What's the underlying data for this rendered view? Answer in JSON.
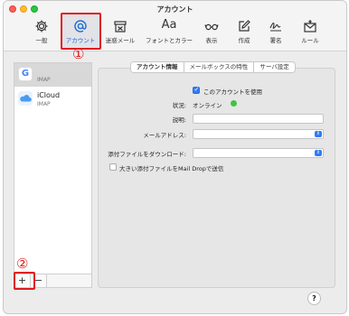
{
  "window": {
    "title": "アカウント"
  },
  "toolbar": {
    "items": [
      {
        "label": "一般",
        "icon": "gear-icon"
      },
      {
        "label": "アカウント",
        "icon": "at-sign-icon",
        "active": true
      },
      {
        "label": "迷惑メール",
        "icon": "junk-mail-icon"
      },
      {
        "label": "フォントとカラー",
        "icon": "font-icon",
        "glyph": "Aa"
      },
      {
        "label": "表示",
        "icon": "glasses-icon"
      },
      {
        "label": "作成",
        "icon": "compose-icon"
      },
      {
        "label": "署名",
        "icon": "signature-icon"
      },
      {
        "label": "ルール",
        "icon": "rules-envelope-icon"
      }
    ],
    "accent": "#1a6cd6"
  },
  "annotations": {
    "callout1": "①",
    "callout2": "②",
    "color": "#e0191b"
  },
  "sidebar": {
    "accounts": [
      {
        "name": "",
        "type": "IMAP",
        "icon": "google-icon",
        "selected": true
      },
      {
        "name": "iCloud",
        "type": "IMAP",
        "icon": "icloud-icon",
        "selected": false
      }
    ],
    "add_label": "+",
    "remove_label": "−"
  },
  "tabs": [
    {
      "label": "アカウント情報",
      "active": true
    },
    {
      "label": "メールボックスの特性",
      "active": false
    },
    {
      "label": "サーバ設定",
      "active": false
    }
  ],
  "form": {
    "enable_label": "このアカウントを使用",
    "enable_checked": true,
    "status_label": "状況:",
    "status_value": "オンライン",
    "status_color": "#3ec43e",
    "description_label": "説明:",
    "description_value": "",
    "email_label": "メールアドレス:",
    "email_value": "",
    "download_label": "添付ファイルをダウンロード:",
    "download_value": "",
    "maildrop_label": "大きい添付ファイルをMail Dropで送信",
    "maildrop_checked": false
  },
  "help_label": "?"
}
